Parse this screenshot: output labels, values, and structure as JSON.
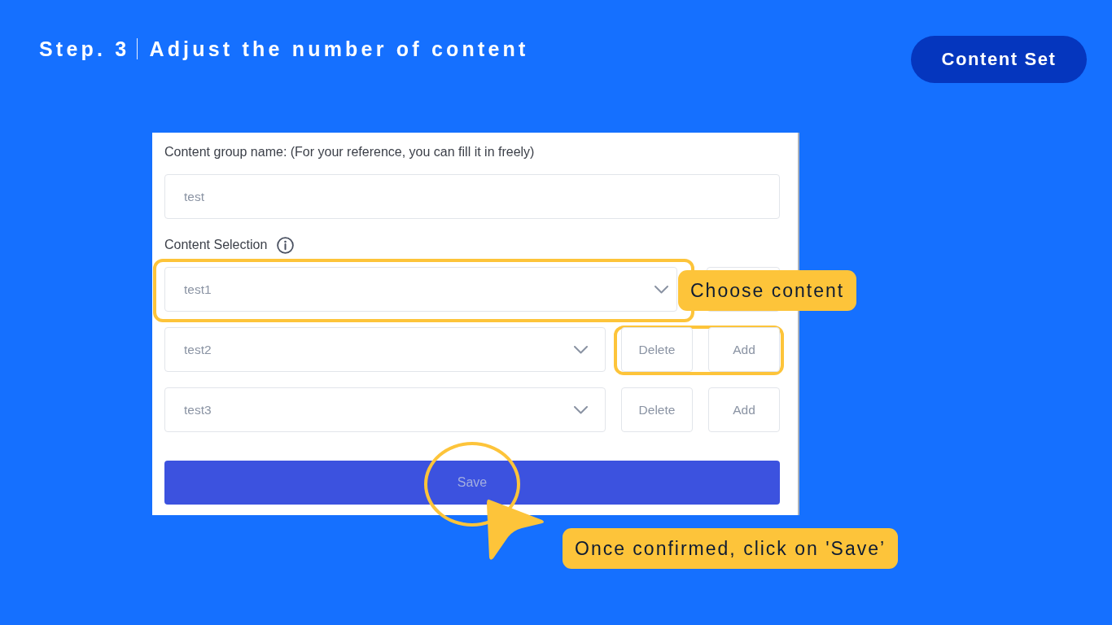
{
  "header": {
    "step": "Step. 3",
    "title": "Adjust the number of content"
  },
  "badge": {
    "label": "Content Set"
  },
  "form": {
    "group_name": {
      "label": "Content group name: (For your reference, you can fill it in freely)",
      "value": "test"
    },
    "selection": {
      "label": "Content Selection"
    },
    "rows": [
      {
        "kind": "wide",
        "value": "test1",
        "select_framed": true,
        "buttons_framed": false
      },
      {
        "kind": "pair",
        "value": "test2",
        "buttons": [
          "Delete",
          "Add"
        ],
        "select_framed": false,
        "buttons_framed": true
      },
      {
        "kind": "pair",
        "value": "test3",
        "buttons": [
          "Delete",
          "Add"
        ],
        "select_framed": false,
        "buttons_framed": false
      }
    ],
    "save": {
      "label": "Save",
      "circled": true
    }
  },
  "callouts": [
    {
      "text": "Choose content"
    },
    {
      "text": "Once confirmed, click on 'Save’"
    }
  ]
}
